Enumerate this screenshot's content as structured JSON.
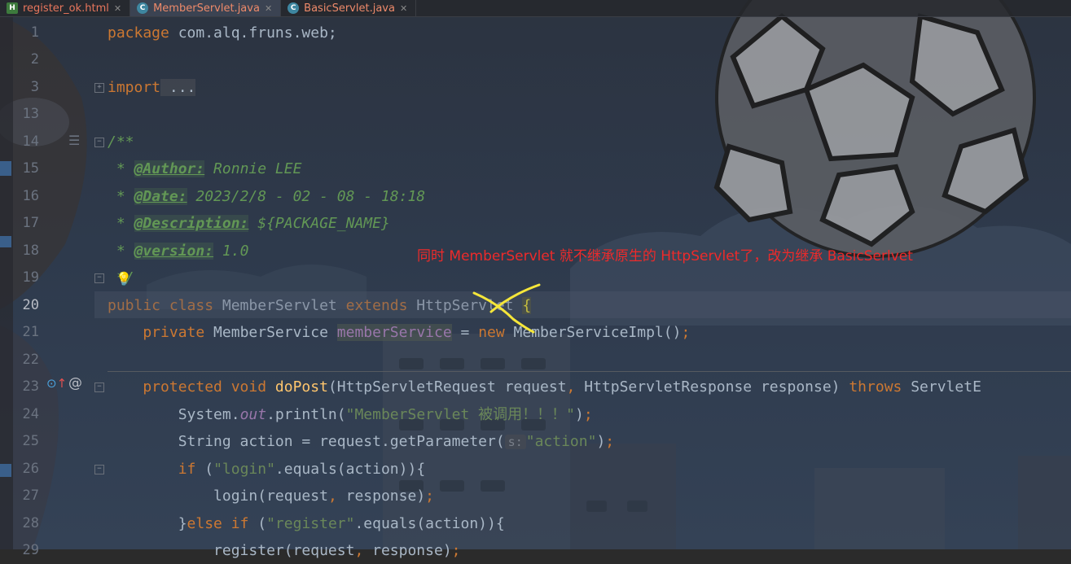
{
  "tabs": [
    {
      "label": "register_ok.html",
      "icon": "html-file-icon",
      "active": false
    },
    {
      "label": "MemberServlet.java",
      "icon": "java-class-icon",
      "active": true
    },
    {
      "label": "BasicServlet.java",
      "icon": "java-class-icon",
      "active": false
    }
  ],
  "line_numbers": [
    "1",
    "2",
    "3",
    "13",
    "14",
    "15",
    "16",
    "17",
    "18",
    "19",
    "20",
    "21",
    "22",
    "23",
    "24",
    "25",
    "26",
    "27",
    "28",
    "29"
  ],
  "code": {
    "l1_kw": "package",
    "l1_rest": " com.alq.fruns.web;",
    "l3_kw": "import",
    "l3_fold": " ...",
    "l14": "/**",
    "l15_pre": " * ",
    "l15_tag": "@Author:",
    "l15_val": " Ronnie LEE",
    "l16_pre": " * ",
    "l16_tag": "@Date:",
    "l16_val": " 2023/2/8 - 02 - 08 - 18:18",
    "l17_pre": " * ",
    "l17_tag": "@Description:",
    "l17_val": " ${PACKAGE_NAME}",
    "l18_pre": " * ",
    "l18_tag": "@version:",
    "l18_val": " 1.0",
    "l19": " */",
    "l20_kw1": "public class",
    "l20_name": " MemberServlet ",
    "l20_kw2": "extends",
    "l20_sup": " HttpServlet ",
    "l20_brace": "{",
    "l21_kw": "    private",
    "l21_type": " MemberService ",
    "l21_field": "memberService",
    "l21_eq": " = ",
    "l21_new": "new",
    "l21_rest": " MemberServiceImpl()",
    "l21_semi": ";",
    "l23_kw": "    protected void",
    "l23_fn": " doPost",
    "l23_args": "(HttpServletRequest request",
    "l23_c1": ",",
    "l23_args2": " HttpServletResponse response) ",
    "l23_throws": "throws",
    "l23_exc": " ServletE",
    "l24_a": "        System.",
    "l24_out": "out",
    "l24_b": ".println(",
    "l24_str": "\"MemberServlet 被调用！！！\"",
    "l24_c": ")",
    "l24_semi": ";",
    "l25_a": "        String action = request.getParameter(",
    "l25_hint": "s:",
    "l25_str": "\"action\"",
    "l25_c": ")",
    "l25_semi": ";",
    "l26_kw": "        if",
    "l26_a": " (",
    "l26_str": "\"login\"",
    "l26_b": ".equals(action)){",
    "l27_a": "            login(request",
    "l27_c": ",",
    "l27_b": " response)",
    "l27_semi": ";",
    "l28_a": "        }",
    "l28_kw": "else if",
    "l28_b": " (",
    "l28_str": "\"register\"",
    "l28_c": ".equals(action)){",
    "l29_a": "            register(request",
    "l29_c": ",",
    "l29_b": " response)",
    "l29_semi": ";"
  },
  "annotation": "同时 MemberServlet 就不继承原生的 HttpServlet了，改为继承 BasicSerlvet",
  "colors": {
    "keyword": "#cc7832",
    "string": "#6a8759",
    "doc": "#629755",
    "function": "#ffc66d",
    "field": "#9876aa",
    "annotation": "#ee2a2a",
    "crossout": "#f5e63a"
  }
}
